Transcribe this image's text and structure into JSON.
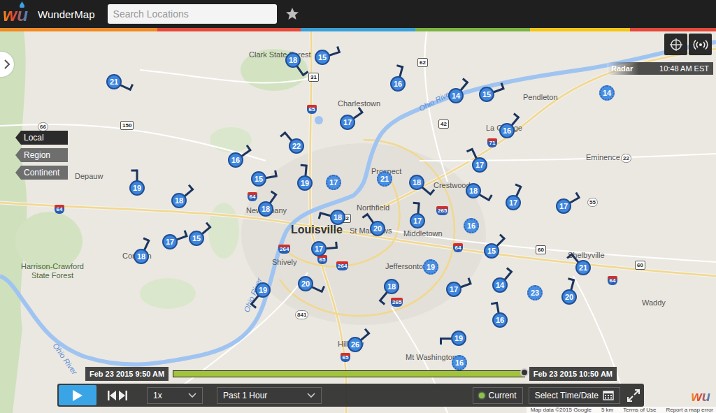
{
  "app": {
    "logo": "wu",
    "title": "WunderMap"
  },
  "search": {
    "placeholder": "Search Locations"
  },
  "scale_buttons": [
    {
      "label": "Local",
      "selected": true
    },
    {
      "label": "Region",
      "selected": false
    },
    {
      "label": "Continent",
      "selected": false
    }
  ],
  "radar": {
    "label": "Radar",
    "time": "10:48 AM EST"
  },
  "stations": [
    {
      "speed": "21",
      "direction": 25,
      "kind": "wind"
    },
    {
      "speed": "18",
      "direction": 55,
      "kind": "wind"
    },
    {
      "speed": "15",
      "direction": -18,
      "kind": "wind"
    },
    {
      "speed": "16",
      "direction": -75,
      "kind": "wind"
    },
    {
      "speed": "14",
      "direction": -50,
      "kind": "wind"
    },
    {
      "speed": "15",
      "direction": -20,
      "kind": "wind"
    },
    {
      "speed": "14",
      "kind": "calm"
    },
    {
      "speed": "17",
      "direction": -35,
      "kind": "wind"
    },
    {
      "speed": "16",
      "direction": -50,
      "kind": "wind"
    },
    {
      "speed": "22",
      "direction": -130,
      "kind": "wind"
    },
    {
      "speed": "16",
      "direction": -35,
      "kind": "wind"
    },
    {
      "speed": "17",
      "direction": -115,
      "kind": "wind"
    },
    {
      "speed": "15",
      "direction": -10,
      "kind": "wind"
    },
    {
      "speed": "19",
      "direction": -85,
      "kind": "wind"
    },
    {
      "speed": "17",
      "kind": "calm"
    },
    {
      "speed": "21",
      "kind": "calm"
    },
    {
      "speed": "18",
      "direction": 40,
      "kind": "wind"
    },
    {
      "speed": "19",
      "direction": -90,
      "kind": "wind"
    },
    {
      "speed": "18",
      "direction": -40,
      "kind": "wind"
    },
    {
      "speed": "18",
      "direction": -55,
      "kind": "wind"
    },
    {
      "speed": "18",
      "direction": -165,
      "kind": "wind"
    },
    {
      "speed": "18",
      "direction": 30,
      "kind": "wind"
    },
    {
      "speed": "17",
      "direction": -65,
      "kind": "wind"
    },
    {
      "speed": "17",
      "direction": -30,
      "kind": "wind"
    },
    {
      "speed": "17",
      "direction": -85,
      "kind": "wind"
    },
    {
      "speed": "20",
      "direction": -125,
      "kind": "wind"
    },
    {
      "speed": "16",
      "kind": "calm"
    },
    {
      "speed": "17",
      "direction": -20,
      "kind": "wind"
    },
    {
      "speed": "15",
      "direction": -40,
      "kind": "wind"
    },
    {
      "speed": "18",
      "direction": -65,
      "kind": "wind"
    },
    {
      "speed": "17",
      "direction": -5,
      "kind": "wind"
    },
    {
      "speed": "15",
      "direction": -45,
      "kind": "wind"
    },
    {
      "speed": "21",
      "direction": -130,
      "kind": "wind"
    },
    {
      "speed": "19",
      "kind": "calm"
    },
    {
      "speed": "19",
      "direction": 130,
      "kind": "wind"
    },
    {
      "speed": "20",
      "direction": 25,
      "kind": "wind"
    },
    {
      "speed": "18",
      "direction": 130,
      "kind": "wind"
    },
    {
      "speed": "17",
      "direction": -20,
      "kind": "wind"
    },
    {
      "speed": "14",
      "direction": -50,
      "kind": "wind"
    },
    {
      "speed": "23",
      "kind": "calm"
    },
    {
      "speed": "20",
      "direction": -75,
      "kind": "wind"
    },
    {
      "speed": "16",
      "direction": -100,
      "kind": "wind"
    },
    {
      "speed": "19",
      "direction": 180,
      "kind": "wind"
    },
    {
      "speed": "26",
      "direction": -40,
      "kind": "wind"
    },
    {
      "speed": "16",
      "kind": "calm"
    }
  ],
  "places": [
    {
      "name": "Clark State Forest",
      "kind": "town"
    },
    {
      "name": "Charlestown",
      "kind": "town"
    },
    {
      "name": "Pendleton",
      "kind": "town"
    },
    {
      "name": "La Grange",
      "kind": "town"
    },
    {
      "name": "Eminence",
      "kind": "town"
    },
    {
      "name": "Depauw",
      "kind": "town"
    },
    {
      "name": "Prospect",
      "kind": "town"
    },
    {
      "name": "Crestwood",
      "kind": "town"
    },
    {
      "name": "New Albany",
      "kind": "town"
    },
    {
      "name": "Louisville",
      "kind": "city"
    },
    {
      "name": "Northfield",
      "kind": "town"
    },
    {
      "name": "St Matthews",
      "kind": "town"
    },
    {
      "name": "Middletown",
      "kind": "town"
    },
    {
      "name": "Shively",
      "kind": "town"
    },
    {
      "name": "Jeffersontown",
      "kind": "town"
    },
    {
      "name": "Shelbyville",
      "kind": "town"
    },
    {
      "name": "Harrison-Crawford State Forest",
      "kind": "park"
    },
    {
      "name": "Corydon",
      "kind": "town"
    },
    {
      "name": "Waddy",
      "kind": "town"
    },
    {
      "name": "Hillview",
      "kind": "town"
    },
    {
      "name": "Mt Washington",
      "kind": "town"
    },
    {
      "name": "Ohio River",
      "kind": "river"
    },
    {
      "name": "Ohio River",
      "kind": "river"
    },
    {
      "name": "Ohio River",
      "kind": "river"
    }
  ],
  "route_shields": [
    {
      "number": "150",
      "kind": "us"
    },
    {
      "number": "66",
      "kind": "state"
    },
    {
      "number": "31",
      "kind": "us"
    },
    {
      "number": "62",
      "kind": "us"
    },
    {
      "number": "65",
      "kind": "interstate"
    },
    {
      "number": "42",
      "kind": "us"
    },
    {
      "number": "71",
      "kind": "interstate"
    },
    {
      "number": "22",
      "kind": "state"
    },
    {
      "number": "64",
      "kind": "interstate"
    },
    {
      "number": "265",
      "kind": "interstate"
    },
    {
      "number": "55",
      "kind": "state"
    },
    {
      "number": "60",
      "kind": "us"
    },
    {
      "number": "60",
      "kind": "us"
    },
    {
      "number": "264",
      "kind": "interstate"
    },
    {
      "number": "65",
      "kind": "interstate"
    },
    {
      "number": "264",
      "kind": "interstate"
    },
    {
      "number": "64",
      "kind": "interstate"
    },
    {
      "number": "64",
      "kind": "interstate"
    },
    {
      "number": "841",
      "kind": "state"
    },
    {
      "number": "265",
      "kind": "interstate"
    },
    {
      "number": "42",
      "kind": "us"
    },
    {
      "number": "64",
      "kind": "interstate"
    },
    {
      "number": "65",
      "kind": "interstate"
    }
  ],
  "timeline": {
    "start": "Feb 23 2015 9:50 AM",
    "end": "Feb 23 2015 10:50 AM",
    "level": 1
  },
  "controls": {
    "speed": "1x",
    "range": "Past 1 Hour",
    "current": {
      "label": "Current",
      "on": true
    },
    "select": "Select Time/Date"
  },
  "footer_logo": "wu",
  "attribution": [
    "Map data ©2015 Google",
    "5 km",
    "Terms of Use",
    "Report a map error"
  ]
}
